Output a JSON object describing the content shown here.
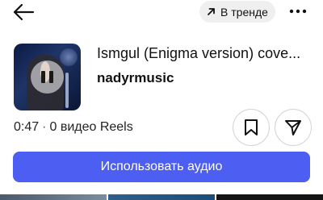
{
  "header": {
    "back_icon": "arrow-left-icon",
    "trend_label": "В тренде",
    "trend_icon": "arrow-up-right-icon",
    "more_icon": "more-horizontal-icon"
  },
  "audio": {
    "title": "Ismgul (Enigma version) cove...",
    "artist": "nadyrmusic",
    "play_state_icon": "pause-icon"
  },
  "meta": {
    "duration": "0:47",
    "reels_count": "0 видео Reels"
  },
  "actions": {
    "save_icon": "bookmark-icon",
    "share_icon": "send-icon",
    "use_audio_label": "Использовать аудио"
  },
  "colors": {
    "accent": "#4d5ef2",
    "chip_bg": "#efeff0"
  }
}
